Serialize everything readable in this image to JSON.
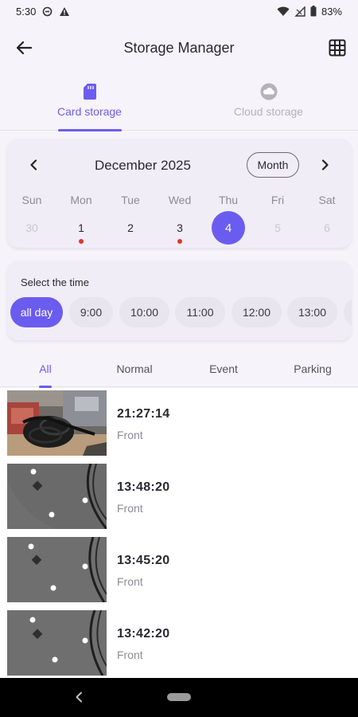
{
  "status_bar": {
    "time": "5:30",
    "battery": "83%"
  },
  "header": {
    "title": "Storage Manager"
  },
  "storage_tabs": [
    {
      "label": "Card storage",
      "active": true,
      "icon": "sd-card-icon"
    },
    {
      "label": "Cloud storage",
      "active": false,
      "icon": "cloud-icon"
    }
  ],
  "calendar": {
    "month_label": "December 2025",
    "view_mode": "Month",
    "weekdays": [
      "Sun",
      "Mon",
      "Tue",
      "Wed",
      "Thu",
      "Fri",
      "Sat"
    ],
    "days": [
      {
        "label": "30",
        "state": "muted",
        "has_recording": false
      },
      {
        "label": "1",
        "state": "normal",
        "has_recording": true
      },
      {
        "label": "2",
        "state": "normal",
        "has_recording": false
      },
      {
        "label": "3",
        "state": "normal",
        "has_recording": true
      },
      {
        "label": "4",
        "state": "selected",
        "has_recording": false
      },
      {
        "label": "5",
        "state": "muted",
        "has_recording": false
      },
      {
        "label": "6",
        "state": "muted",
        "has_recording": false
      }
    ]
  },
  "time_filter": {
    "title": "Select the time",
    "chips": [
      {
        "label": "all day",
        "active": true
      },
      {
        "label": "9:00",
        "active": false
      },
      {
        "label": "10:00",
        "active": false
      },
      {
        "label": "11:00",
        "active": false
      },
      {
        "label": "12:00",
        "active": false
      },
      {
        "label": "13:00",
        "active": false
      },
      {
        "label": "",
        "active": false
      }
    ]
  },
  "filter_tabs": [
    {
      "label": "All",
      "active": true
    },
    {
      "label": "Normal",
      "active": false
    },
    {
      "label": "Event",
      "active": false
    },
    {
      "label": "Parking",
      "active": false
    }
  ],
  "recordings": [
    {
      "time": "21:27:14",
      "camera": "Front",
      "thumbnail": "cables-scene"
    },
    {
      "time": "13:48:20",
      "camera": "Front",
      "thumbnail": "ceiling-lights"
    },
    {
      "time": "13:45:20",
      "camera": "Front",
      "thumbnail": "ceiling-lights"
    },
    {
      "time": "13:42:20",
      "camera": "Front",
      "thumbnail": "ceiling-lights"
    }
  ],
  "colors": {
    "accent": "#6b5cf0",
    "recording_dot": "#e4352a",
    "card_bg": "#f1edf7"
  }
}
